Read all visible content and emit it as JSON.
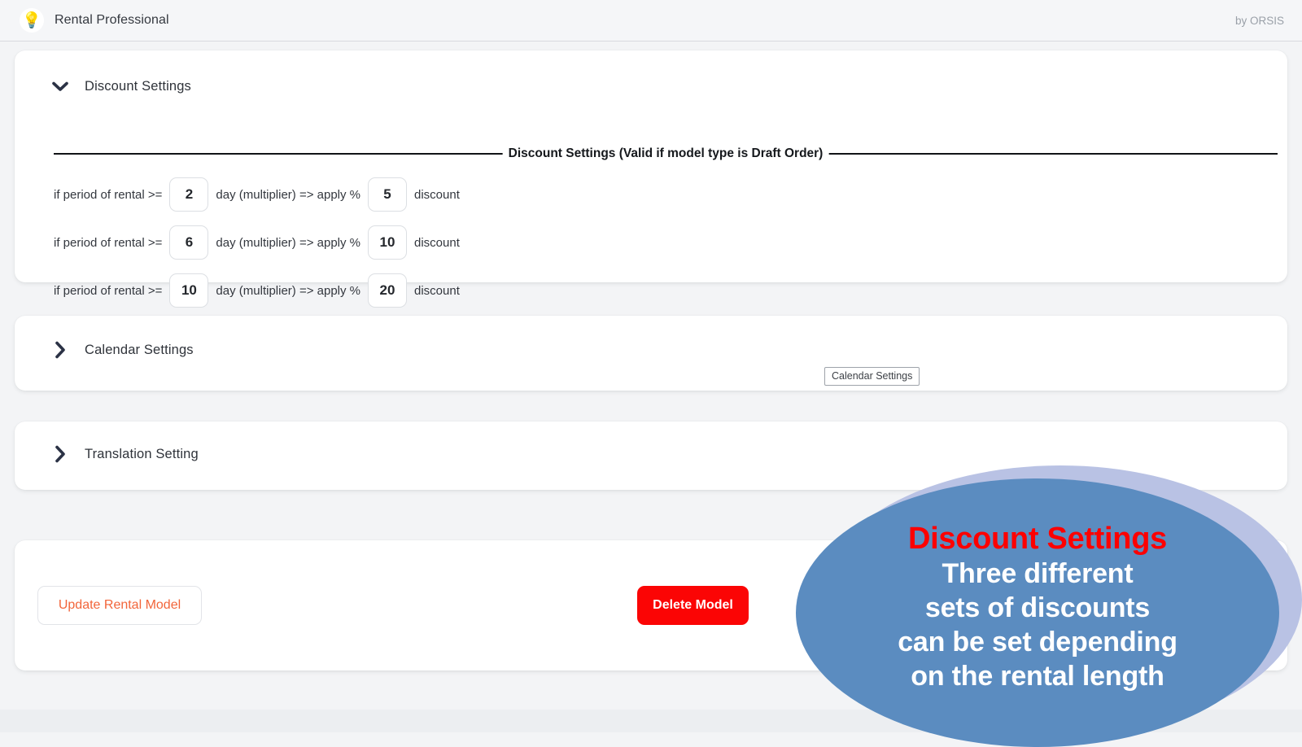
{
  "topbar": {
    "logo_icon": "lightbulb-icon",
    "logo_glyph": "💡",
    "app_name": "Rental Professional",
    "attribution": "by ORSIS"
  },
  "discount_section": {
    "header_label": "Discount Settings",
    "chevron_icon": "chevron-down-icon",
    "expanded": true,
    "legend": "Discount Settings (Valid if model type is Draft Order)",
    "rows": [
      {
        "prefix": "if period of rental >=",
        "days": "2",
        "middle": "day (multiplier) => apply %",
        "percent": "5",
        "suffix": "discount"
      },
      {
        "prefix": "if period of rental >=",
        "days": "6",
        "middle": "day (multiplier) => apply %",
        "percent": "10",
        "suffix": "discount"
      },
      {
        "prefix": "if period of rental >=",
        "days": "10",
        "middle": "day (multiplier) => apply %",
        "percent": "20",
        "suffix": "discount"
      }
    ]
  },
  "calendar_section": {
    "header_label": "Calendar Settings",
    "chevron_icon": "chevron-right-icon",
    "expanded": false,
    "tooltip_label": "Calendar Settings"
  },
  "translation_section": {
    "header_label": "Translation Setting",
    "chevron_icon": "chevron-right-icon",
    "expanded": false
  },
  "actions": {
    "update_label": "Update Rental Model",
    "delete_label": "Delete Model"
  },
  "annotation": {
    "title": "Discount Settings",
    "line1": "Three different",
    "line2": "sets of discounts",
    "line3": "can be set depending",
    "line4": "on the rental length"
  },
  "colors": {
    "page_background": "#f3f4f6",
    "card_background": "#ffffff",
    "chevron": "#2b3245",
    "update_button_text": "#f2653a",
    "delete_button_background": "#fb0505",
    "annotation_bubble": "#5b8cc0",
    "annotation_halo": "#b9c2e4",
    "annotation_title": "#fd0000"
  }
}
